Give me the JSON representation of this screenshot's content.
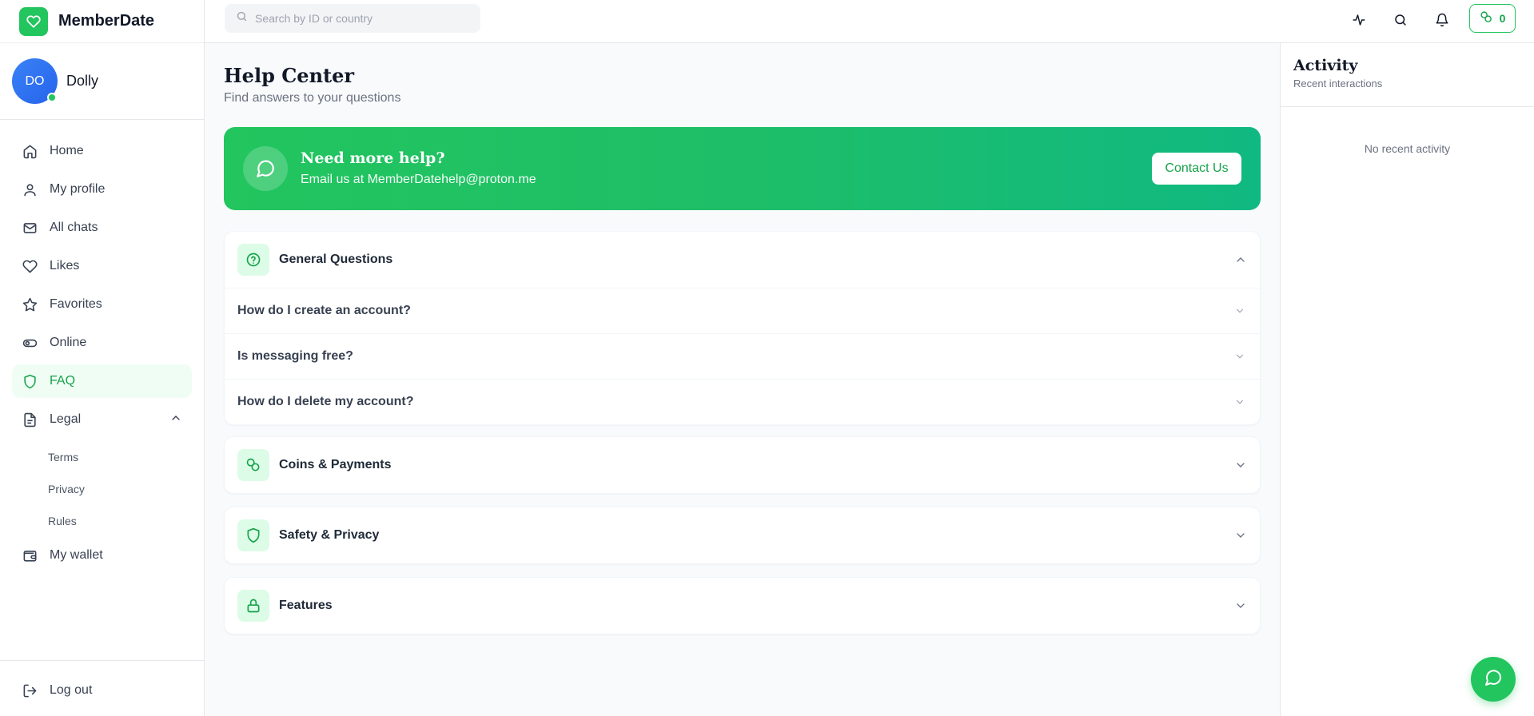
{
  "app": {
    "name": "MemberDate",
    "brand_color": "#22c55e"
  },
  "user": {
    "initials": "DO",
    "name": "Dolly",
    "status": "online"
  },
  "sidebar": {
    "items": [
      {
        "label": "Home",
        "icon": "home-icon"
      },
      {
        "label": "My profile",
        "icon": "user-icon"
      },
      {
        "label": "All chats",
        "icon": "mail-icon"
      },
      {
        "label": "Likes",
        "icon": "heart-icon"
      },
      {
        "label": "Favorites",
        "icon": "star-icon"
      },
      {
        "label": "Online",
        "icon": "toggle-icon"
      },
      {
        "label": "FAQ",
        "icon": "shield-icon",
        "active": true
      },
      {
        "label": "Legal",
        "icon": "document-icon",
        "expanded": true
      }
    ],
    "legal_sub": [
      "Terms",
      "Privacy",
      "Rules"
    ],
    "wallet": {
      "label": "My wallet",
      "icon": "wallet-icon"
    },
    "logout": {
      "label": "Log out",
      "icon": "logout-icon"
    }
  },
  "topbar": {
    "search_placeholder": "Search by ID or country",
    "coins": "0"
  },
  "main": {
    "title": "Help Center",
    "subtitle": "Find answers to your questions",
    "banner": {
      "title": "Need more help?",
      "text": "Email us at MemberDatehelp@proton.me",
      "button": "Contact Us"
    },
    "sections": [
      {
        "title": "General Questions",
        "icon": "help-circle-icon",
        "expanded": true,
        "questions": [
          "How do I create an account?",
          "Is messaging free?",
          "How do I delete my account?"
        ]
      },
      {
        "title": "Coins & Payments",
        "icon": "coins-icon",
        "expanded": false
      },
      {
        "title": "Safety & Privacy",
        "icon": "shield-icon",
        "expanded": false
      },
      {
        "title": "Features",
        "icon": "lock-icon",
        "expanded": false
      }
    ]
  },
  "activity": {
    "title": "Activity",
    "subtitle": "Recent interactions",
    "empty": "No recent activity"
  }
}
